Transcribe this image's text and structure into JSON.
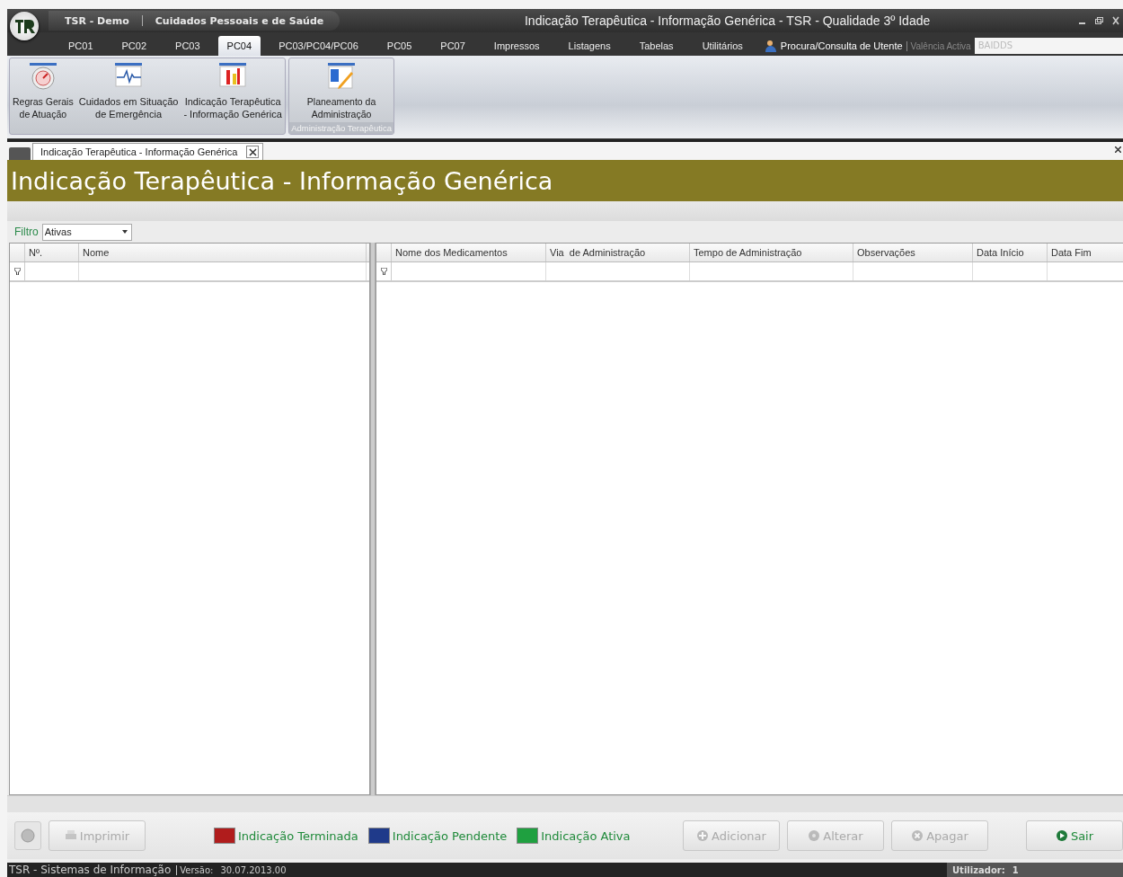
{
  "window": {
    "app_name": "TSR - Demo",
    "module": "Cuidados Pessoais e de Saúde",
    "title": "Indicação Terapêutica - Informação Genérica - TSR - Qualidade 3º Idade"
  },
  "menu_tabs": [
    {
      "label": "PC01",
      "selected": false
    },
    {
      "label": "PC02",
      "selected": false
    },
    {
      "label": "PC03",
      "selected": false
    },
    {
      "label": "PC04",
      "selected": true
    },
    {
      "label": "PC03/PC04/PC06",
      "selected": false
    },
    {
      "label": "PC05",
      "selected": false
    },
    {
      "label": "PC07",
      "selected": false
    },
    {
      "label": "Impressos",
      "selected": false
    },
    {
      "label": "Listagens",
      "selected": false
    },
    {
      "label": "Tabelas",
      "selected": false
    },
    {
      "label": "Utilitários",
      "selected": false
    }
  ],
  "utente_search": {
    "label": "Procura/Consulta de Utente",
    "valencia_label": "Valência Activa",
    "valencia_value": "BAIDDS"
  },
  "ribbon_groups": [
    {
      "buttons": [
        {
          "label": "Regras Gerais\nde Atuação"
        },
        {
          "label": "Cuidados em Situação\nde Emergência"
        },
        {
          "label": "Indicação Terapêutica\n- Informação Genérica"
        }
      ]
    },
    {
      "title": "Administração Terapêutica",
      "buttons": [
        {
          "label": "Planeamento da\nAdministração"
        }
      ]
    }
  ],
  "document_tab": {
    "label": "Indicação Terapêutica - Informação Genérica"
  },
  "page_title": "Indicação Terapêutica - Informação Genérica",
  "filter": {
    "label": "Filtro",
    "value": "Ativas"
  },
  "left_grid": {
    "columns": [
      "Nº.",
      "Nome"
    ]
  },
  "right_grid": {
    "columns": [
      "Nome dos Medicamentos",
      "Via  de Administração",
      "Tempo de Administração",
      "Observações",
      "Data Início",
      "Data Fim"
    ]
  },
  "legend": [
    {
      "label": "Indicação Terminada",
      "color": "#b01c1c"
    },
    {
      "label": "Indicação Pendente",
      "color": "#1f3a8a"
    },
    {
      "label": "Indicação Ativa",
      "color": "#1fa040"
    }
  ],
  "buttons": [
    {
      "kind": "imprimir",
      "label": "Imprimir",
      "disabled": true
    },
    {
      "kind": "adicionar",
      "label": "Adicionar",
      "disabled": true
    },
    {
      "kind": "alterar",
      "label": "Alterar",
      "disabled": true
    },
    {
      "kind": "apagar",
      "label": "Apagar",
      "disabled": true
    },
    {
      "kind": "sair",
      "label": "Sair",
      "disabled": false
    }
  ],
  "status_bar": {
    "company": "TSR - Sistemas de Informação",
    "version_label": "Versão:",
    "version": "30.07.2013.00",
    "user_label": "Utilizador:",
    "user": "1"
  }
}
